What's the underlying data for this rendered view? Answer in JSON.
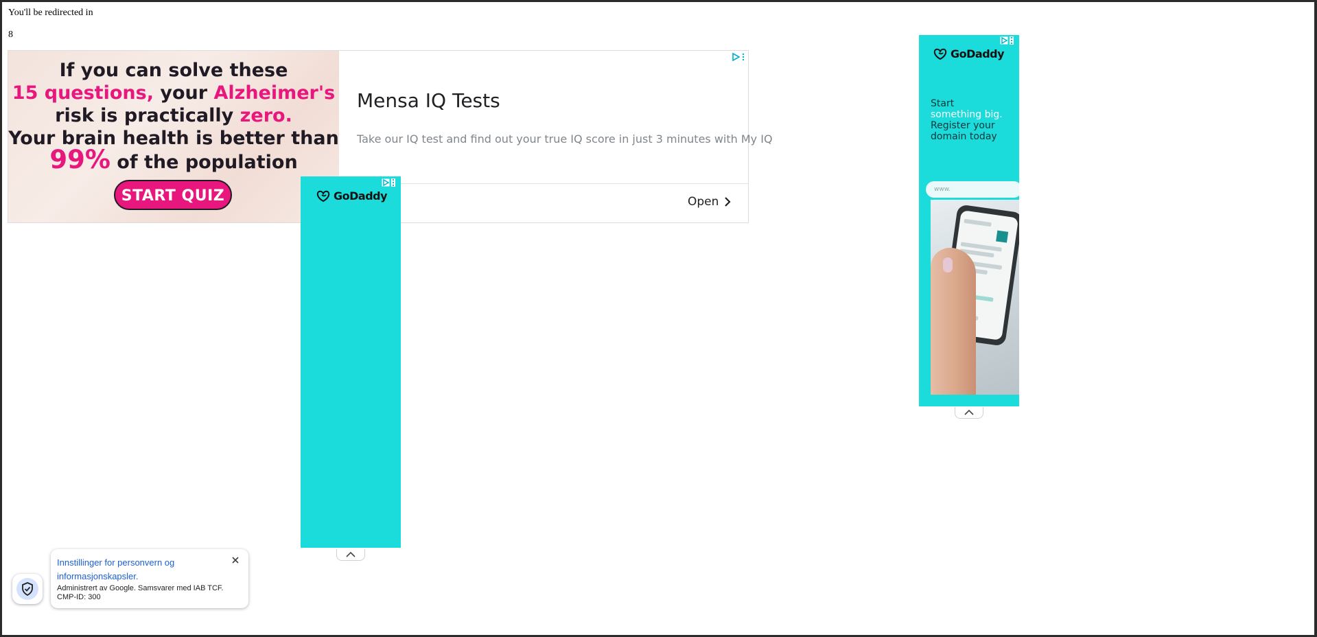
{
  "redirect": {
    "text": "You'll be redirected in",
    "countdown": "8"
  },
  "main_ad": {
    "image_lines": [
      {
        "a": "If you can solve these",
        "b": "",
        "c": "",
        "d": ""
      },
      {
        "a": "15 questions,",
        "b": " your ",
        "c": "Alzheimer's",
        "d": ""
      },
      {
        "a": "risk is practically ",
        "b": "zero.",
        "c": "",
        "d": ""
      },
      {
        "a": "Your brain health is better than",
        "b": "",
        "c": "",
        "d": ""
      },
      {
        "a": "99%",
        "b": " of the population",
        "c": "",
        "d": ""
      }
    ],
    "quiz_button": "START QUIZ",
    "title": "Mensa IQ Tests",
    "description": "Take our IQ test and find out your true IQ score in just 3 minutes with My IQ",
    "open_label": "Open"
  },
  "godaddy_mid": {
    "brand": "GoDaddy"
  },
  "godaddy_right": {
    "brand": "GoDaddy",
    "line1": "Start",
    "line2": "something big.",
    "line3": "Register your",
    "line4": "domain today",
    "input_placeholder": "www."
  },
  "consent": {
    "title": "Innstillinger for personvern og informasjonskapsler.",
    "subtitle": "Administrert av Google. Samsvarer med IAB TCF. CMP-ID: 300"
  },
  "colors": {
    "godaddy_teal": "#1bdbdb",
    "quiz_pink": "#e8177d",
    "consent_link": "#1a5fd6",
    "adchoices_blue": "#00aecd"
  },
  "icons": {
    "adchoices": "adchoices-icon",
    "more": "more-vert-icon",
    "open": "chevron-right-icon",
    "collapse": "chevron-up-icon",
    "shield": "shield-check-icon",
    "close": "close-icon",
    "godaddy": "godaddy-logo-icon"
  }
}
